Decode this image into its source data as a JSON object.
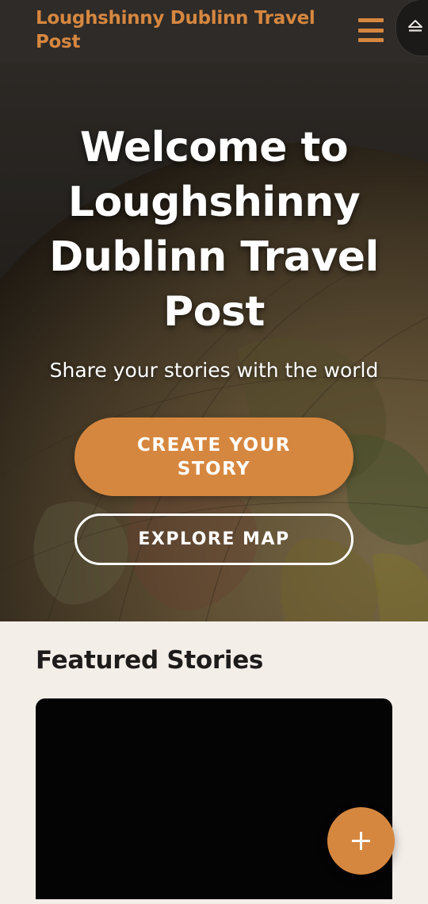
{
  "header": {
    "site_title": "Loughshinny Dublinn Travel Post",
    "menu_icon": "hamburger-menu-icon",
    "eject_icon": "eject-icon"
  },
  "hero": {
    "heading": "Welcome to Loughshinny Dublinn Travel Post",
    "subheading": "Share your stories with the world",
    "create_button": "CREATE YOUR STORY",
    "explore_button": "EXPLORE MAP",
    "background": "globe-photo"
  },
  "featured": {
    "heading": "Featured Stories"
  },
  "fab": {
    "icon": "plus-icon"
  },
  "colors": {
    "accent": "#d6873f",
    "header_bg": "#2e2b28",
    "page_bg": "#f4eee9",
    "card_bg": "#050404"
  }
}
